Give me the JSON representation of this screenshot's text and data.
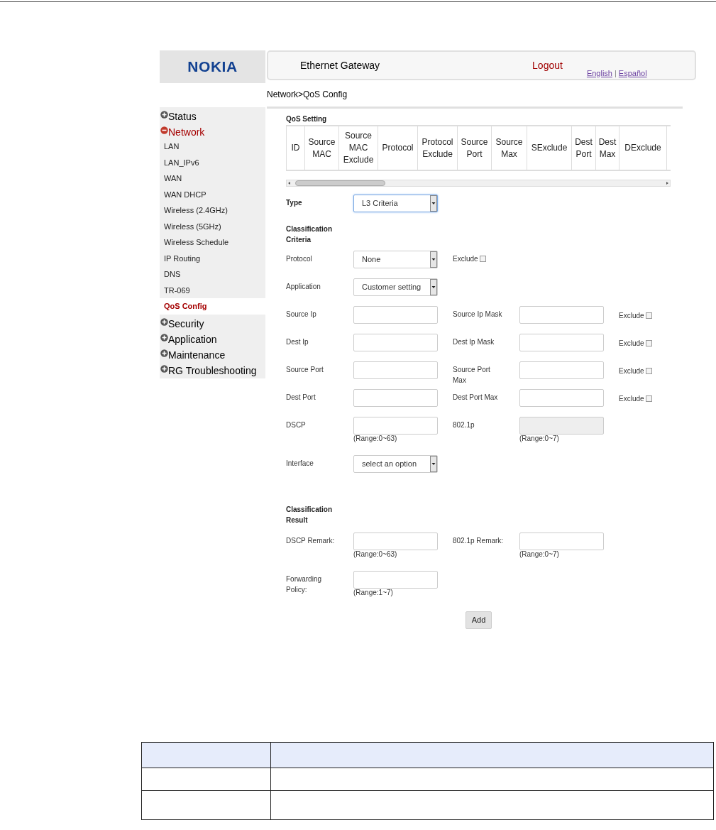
{
  "header": {
    "logo": "NOKIA",
    "title": "Ethernet Gateway",
    "logout": "Logout",
    "languages": [
      {
        "label": "English"
      },
      {
        "label": "Español"
      }
    ],
    "language_separator": "|"
  },
  "breadcrumb": "Network>QoS Config",
  "sidebar": [
    {
      "label": "Status",
      "expanded": false
    },
    {
      "label": "Network",
      "expanded": true,
      "children": [
        {
          "label": "LAN",
          "selected": false
        },
        {
          "label": "LAN_IPv6",
          "selected": false
        },
        {
          "label": "WAN",
          "selected": false
        },
        {
          "label": "WAN DHCP",
          "selected": false
        },
        {
          "label": "Wireless (2.4GHz)",
          "selected": false
        },
        {
          "label": "Wireless (5GHz)",
          "selected": false
        },
        {
          "label": "Wireless Schedule",
          "selected": false
        },
        {
          "label": "IP Routing",
          "selected": false
        },
        {
          "label": "DNS",
          "selected": false
        },
        {
          "label": "TR-069",
          "selected": false
        },
        {
          "label": "QoS Config",
          "selected": true
        }
      ]
    },
    {
      "label": "Security",
      "expanded": false
    },
    {
      "label": "Application",
      "expanded": false
    },
    {
      "label": "Maintenance",
      "expanded": false
    },
    {
      "label": "RG Troubleshooting",
      "expanded": false
    }
  ],
  "qos_setting": {
    "title": "QoS Setting",
    "columns": [
      "ID",
      "Source MAC",
      "Source MAC Exclude",
      "Protocol",
      "Protocol Exclude",
      "Source Port",
      "Source Max",
      "SExclude",
      "Dest Port",
      "Dest Max",
      "DExclude"
    ]
  },
  "form": [
    {
      "kind": "row",
      "label": "Type",
      "bold": true,
      "field": {
        "kind": "select",
        "value": "L3 Criteria",
        "focused": true
      }
    },
    {
      "kind": "heading",
      "label": "Classification Criteria"
    },
    {
      "kind": "row",
      "label": "Protocol",
      "field": {
        "kind": "select",
        "value": "None"
      },
      "right_exclude": {
        "label": "Exclude",
        "checked": false
      }
    },
    {
      "kind": "row",
      "label": "Application",
      "field": {
        "kind": "select",
        "value": "Customer setting"
      }
    },
    {
      "kind": "row",
      "label": "Source Ip",
      "field": {
        "kind": "input"
      },
      "right": {
        "label": "Source Ip Mask",
        "field": {
          "kind": "input"
        }
      },
      "exclude": {
        "label": "Exclude",
        "checked": false
      }
    },
    {
      "kind": "row",
      "label": "Dest Ip",
      "field": {
        "kind": "input"
      },
      "right": {
        "label": "Dest Ip Mask",
        "field": {
          "kind": "input"
        }
      },
      "exclude": {
        "label": "Exclude",
        "checked": false
      }
    },
    {
      "kind": "row",
      "label": "Source Port",
      "field": {
        "kind": "input"
      },
      "right": {
        "label": "Source Port Max",
        "field": {
          "kind": "input"
        }
      },
      "exclude": {
        "label": "Exclude",
        "checked": false
      }
    },
    {
      "kind": "row",
      "label": "Dest Port",
      "field": {
        "kind": "input"
      },
      "right": {
        "label": "Dest Port Max",
        "field": {
          "kind": "input"
        }
      },
      "exclude": {
        "label": "Exclude",
        "checked": false
      }
    },
    {
      "kind": "row",
      "label": "DSCP",
      "field": {
        "kind": "input",
        "hint": "(Range:0~63)"
      },
      "right": {
        "label": "802.1p",
        "field": {
          "kind": "input",
          "disabled": true,
          "hint": "(Range:0~7)"
        }
      }
    },
    {
      "kind": "row",
      "label": "Interface",
      "field": {
        "kind": "select",
        "value": "select an option"
      }
    },
    {
      "kind": "heading",
      "label": "Classification Result"
    },
    {
      "kind": "row",
      "label": "DSCP Remark:",
      "field": {
        "kind": "input",
        "hint": "(Range:0~63)"
      },
      "right": {
        "label": "802.1p Remark:",
        "field": {
          "kind": "input",
          "hint": "(Range:0~7)"
        }
      }
    },
    {
      "kind": "row",
      "label": "Forwarding Policy:",
      "field": {
        "kind": "input",
        "hint": "(Range:1~7)"
      }
    }
  ],
  "add_button": "Add"
}
